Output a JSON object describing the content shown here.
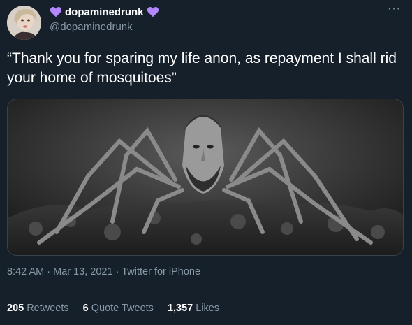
{
  "user": {
    "display_name": "dopaminedrunk",
    "handle": "@dopaminedrunk",
    "badge_color": "#b388ff"
  },
  "tweet": {
    "text": "“Thank you for sparing my life anon, as repayment I shall rid your home of mosquitoes”"
  },
  "meta": {
    "time": "8:42 AM",
    "separator": "·",
    "date": "Mar 13, 2021",
    "source": "Twitter for iPhone"
  },
  "stats": {
    "retweets_count": "205",
    "retweets_label": "Retweets",
    "quotes_count": "6",
    "quotes_label": "Quote Tweets",
    "likes_count": "1,357",
    "likes_label": "Likes"
  },
  "icons": {
    "more": "more-options-icon",
    "heart": "purple-heart-icon"
  }
}
